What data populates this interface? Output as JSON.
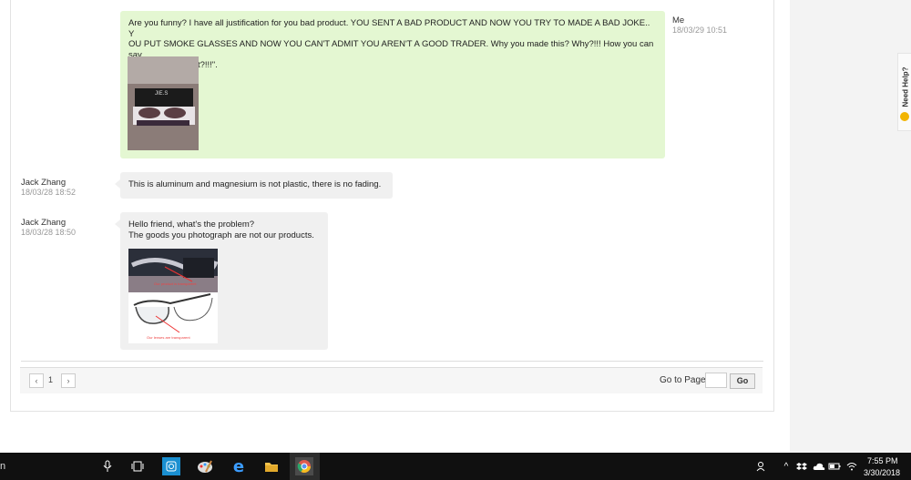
{
  "conversation": {
    "msg_me": {
      "sender": "Me",
      "time": "18/03/29 10:51",
      "text_lines": [
        "Are you funny? I have all justification for you bad product. YOU SENT A BAD PRODUCT AND NOW YOU TRY TO MADE A BAD JOKE.. Y",
        "OU PUT SMOKE GLASSES AND NOW YOU CAN'T ADMIT YOU AREN'T A GOOD TRADER. Why you made this? Why?!!! How you can say",
        "\"It isn't our product?!!!\"."
      ],
      "photo_label": "JIE.S"
    },
    "msg_jack1": {
      "sender": "Jack Zhang",
      "time": "18/03/28 18:52",
      "text": "This is aluminum and magnesium is not plastic, there is no fading."
    },
    "msg_jack2": {
      "sender": "Jack Zhang",
      "time": "18/03/28 18:50",
      "line1": "Hello friend, what's the problem?",
      "line2": "The goods you photograph are not our products.",
      "caption1": "Our product is transparent",
      "caption2": "Our lenses are transparent"
    }
  },
  "pagination": {
    "prev": "‹",
    "page": "1",
    "next": "›",
    "goto_label": "Go to Page",
    "go_button": "Go",
    "page_input_value": ""
  },
  "help_tab": {
    "label": "Need Help?"
  },
  "taskbar": {
    "search_fragment": "n",
    "time": "7:55 PM",
    "date": "3/30/2018"
  },
  "colors": {
    "me_bubble": "#e4f7d2",
    "them_bubble": "#f0f0f0",
    "taskbar": "#101010"
  }
}
